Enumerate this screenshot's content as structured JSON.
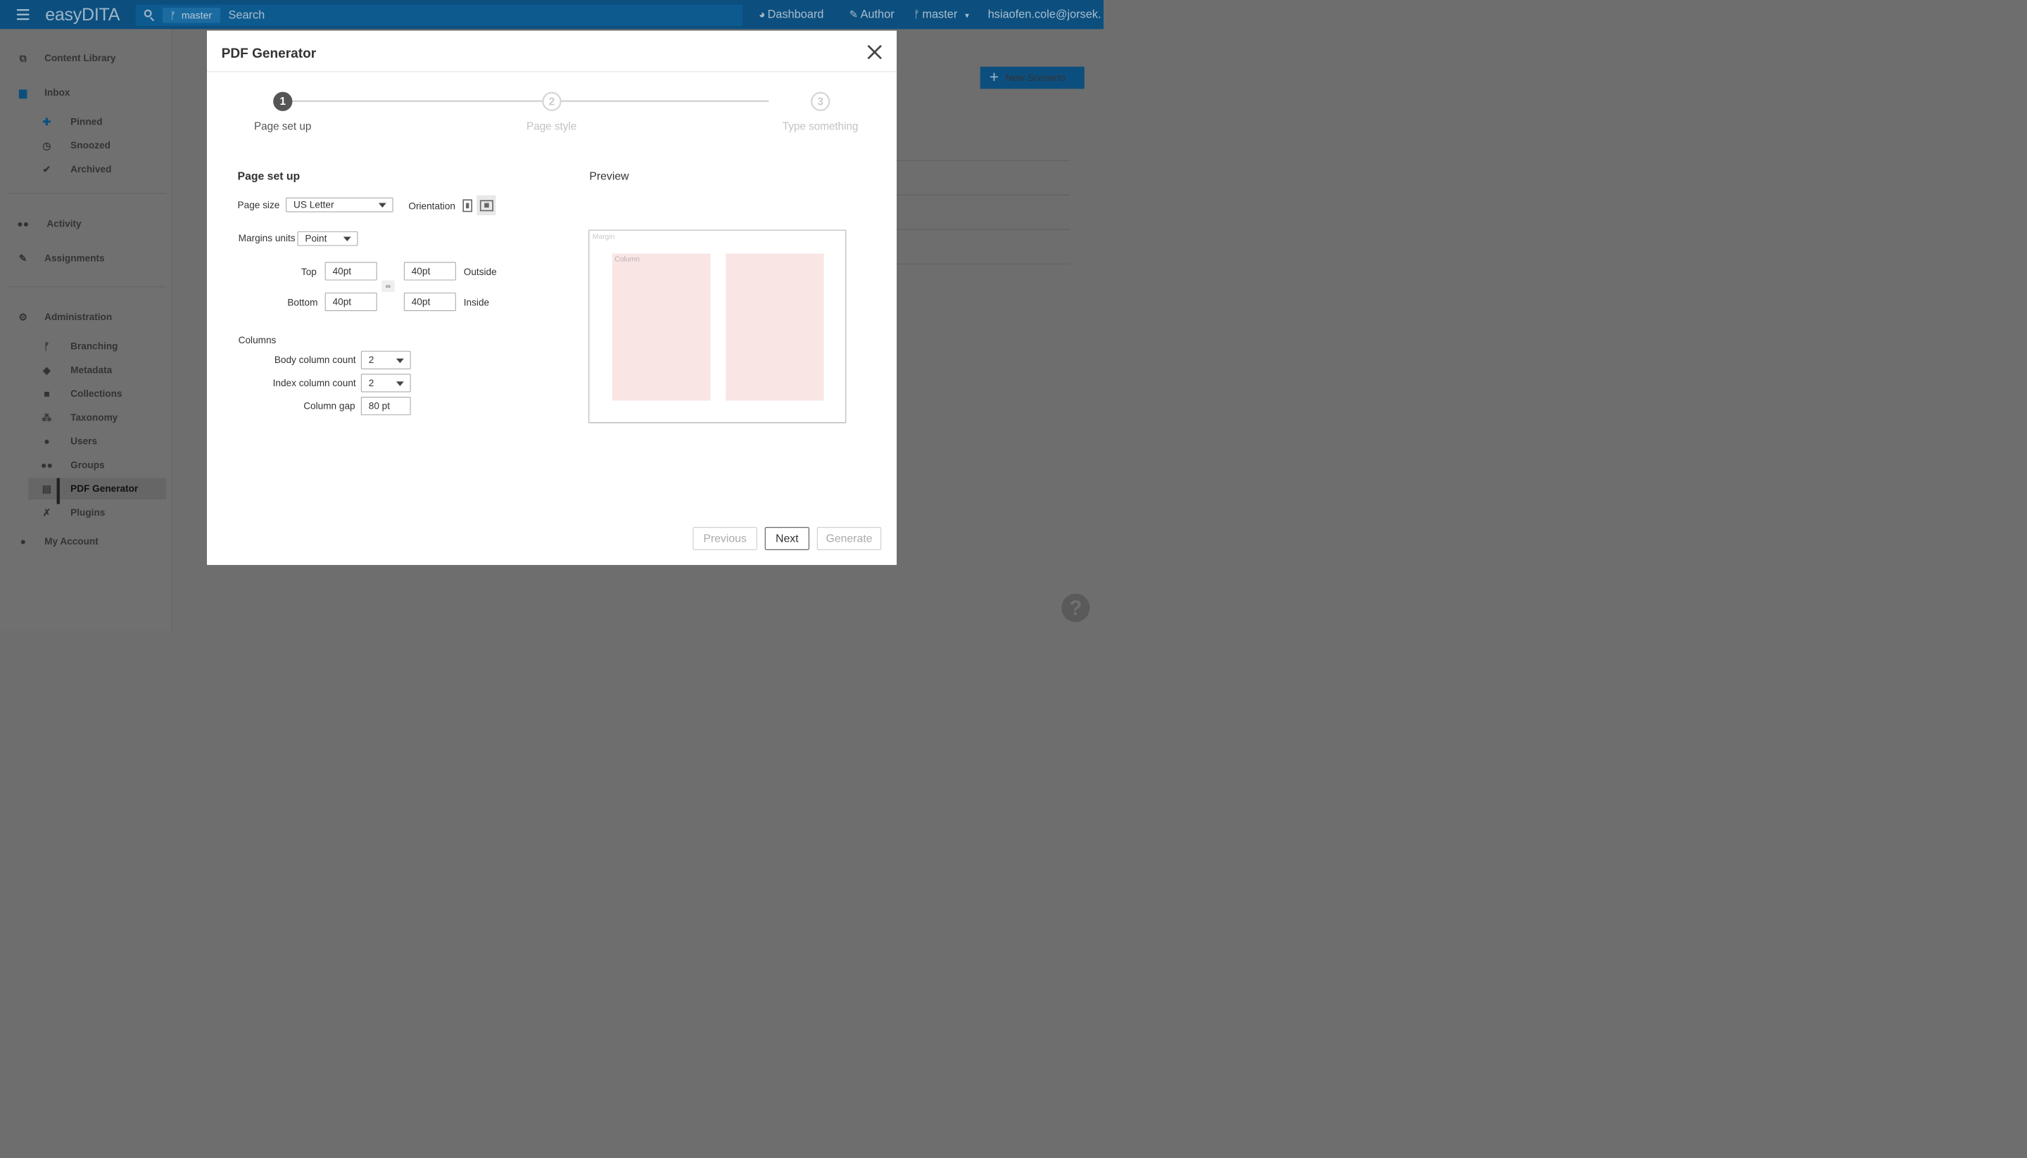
{
  "topbar": {
    "brand": "easyDITA",
    "branch_chip": "master",
    "branch_glyph": "ᚠ",
    "search_placeholder": "Search",
    "nav": {
      "dashboard": "Dashboard",
      "author": "Author",
      "branch": "master",
      "user": "hsiaofen.cole@jorsek."
    }
  },
  "sidebar": {
    "content_library": "Content Library",
    "inbox": "Inbox",
    "pinned": "Pinned",
    "snoozed": "Snoozed",
    "archived": "Archived",
    "activity": "Activity",
    "assignments": "Assignments",
    "administration": "Administration",
    "branching": "Branching",
    "metadata": "Metadata",
    "collections": "Collections",
    "taxonomy": "Taxonomy",
    "users": "Users",
    "groups": "Groups",
    "pdf_generator": "PDF Generator",
    "plugins": "Plugins",
    "my_account": "My Account"
  },
  "main": {
    "new_scenario": "New Scenario",
    "help": "?"
  },
  "modal": {
    "title": "PDF Generator",
    "steps": [
      {
        "number": "1",
        "label": "Page set up",
        "state": "active"
      },
      {
        "number": "2",
        "label": "Page style",
        "state": "inactive"
      },
      {
        "number": "3",
        "label": "Type something",
        "state": "inactive"
      }
    ],
    "section_title": "Page set up",
    "page_size_label": "Page size",
    "page_size_value": "US Letter",
    "orientation_label": "Orientation",
    "orientation_selected": "landscape",
    "margins_units_label": "Margins units",
    "margins_units_value": "Point",
    "margins": {
      "top_label": "Top",
      "top_value": "40pt",
      "bottom_label": "Bottom",
      "bottom_value": "40pt",
      "outside_label": "Outside",
      "outside_value": "40pt",
      "inside_label": "Inside",
      "inside_value": "40pt"
    },
    "columns_label": "Columns",
    "body_column_count_label": "Body column count",
    "body_column_count_value": "2",
    "index_column_count_label": "Index column count",
    "index_column_count_value": "2",
    "column_gap_label": "Column gap",
    "column_gap_value": "80 pt",
    "preview_title": "Preview",
    "preview_margin_label": "Margin",
    "preview_column_label": "Column",
    "buttons": {
      "previous": "Previous",
      "next": "Next",
      "generate": "Generate"
    }
  },
  "colors": {
    "topbar": "#0c4f7f",
    "overlay_bg": "#707070",
    "preview_column": "#fae5e5"
  }
}
